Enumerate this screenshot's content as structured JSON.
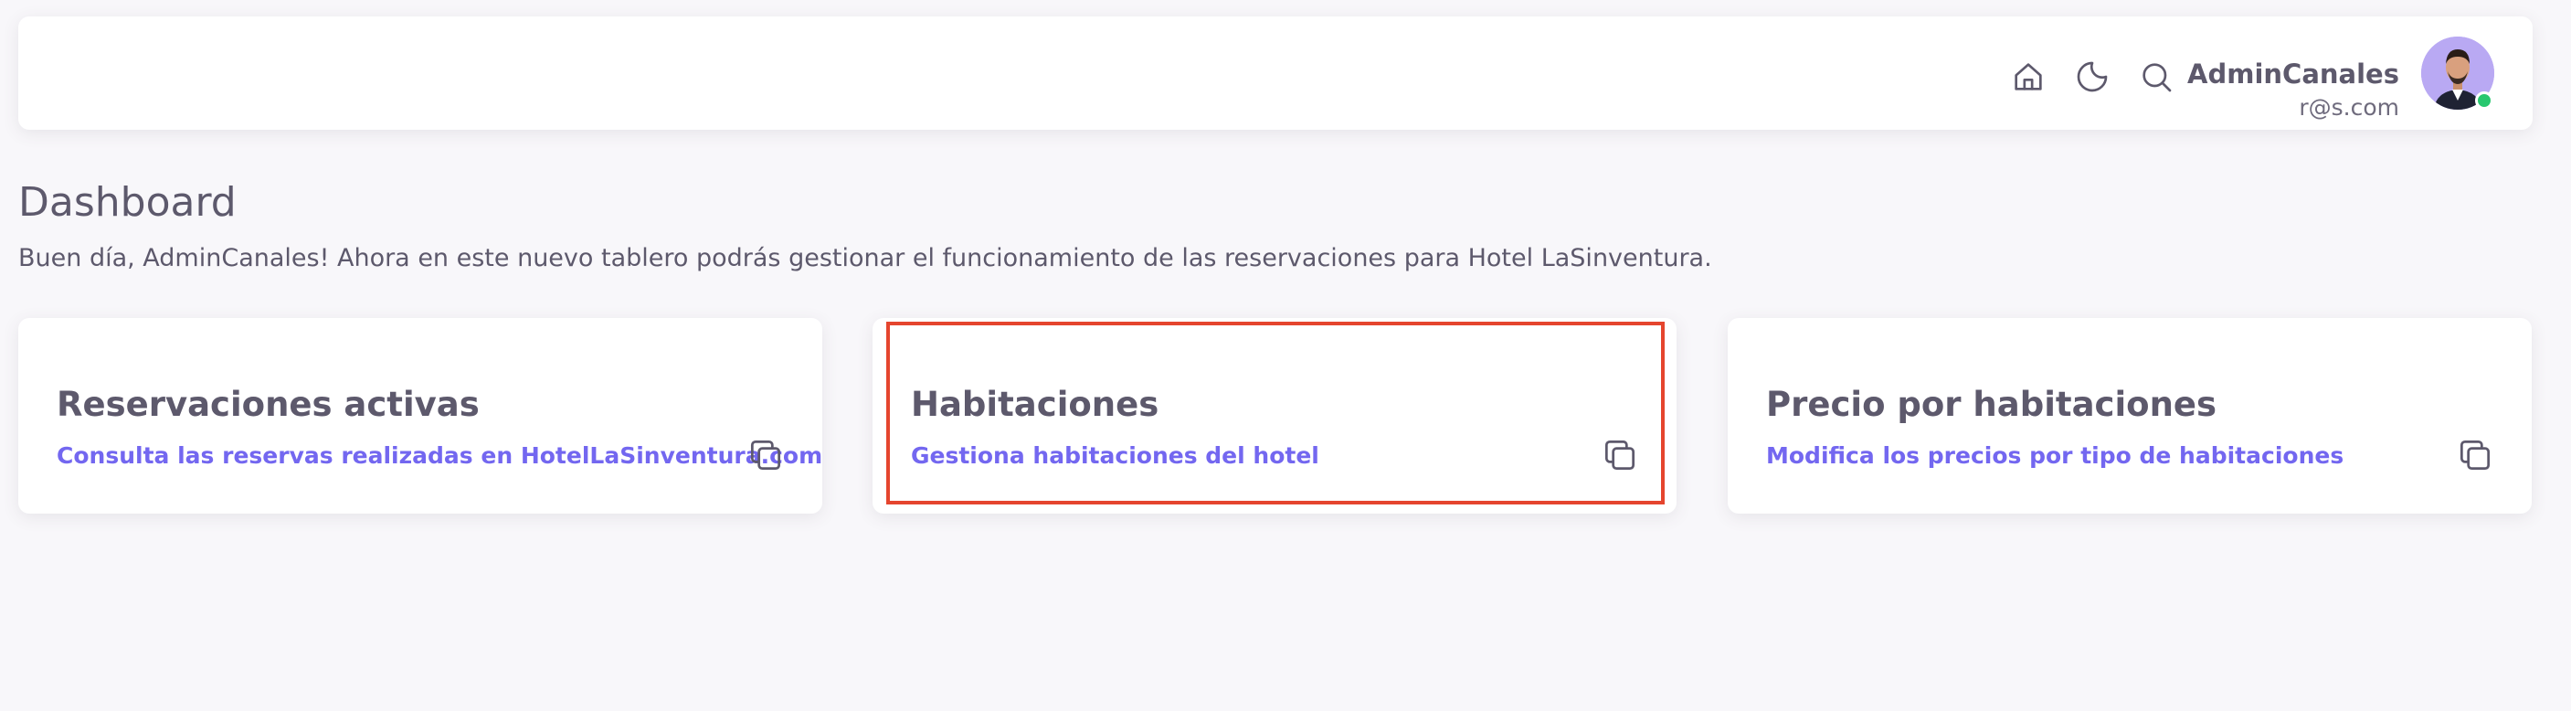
{
  "header": {
    "icons": [
      "home-icon",
      "moon-icon",
      "search-icon"
    ],
    "user": {
      "name": "AdminCanales",
      "email": "r@s.com",
      "status_color": "#28c76f"
    }
  },
  "page": {
    "title": "Dashboard",
    "subtitle": "Buen día, AdminCanales! Ahora en este nuevo tablero podrás gestionar el funcionamiento de las reservaciones para Hotel LaSinventura."
  },
  "cards": [
    {
      "title": "Reservaciones activas",
      "description": "Consulta las reservas realizadas en HotelLaSinventura.com",
      "icon": "copy-icon"
    },
    {
      "title": "Habitaciones",
      "description": "Gestiona habitaciones del hotel",
      "icon": "copy-icon",
      "highlighted": true
    },
    {
      "title": "Precio por habitaciones",
      "description": "Modifica los precios por tipo de habitaciones",
      "icon": "copy-icon"
    }
  ],
  "colors": {
    "accent": "#7367f0",
    "text": "#5d596c",
    "highlight": "#e5452e",
    "background": "#f8f7fa"
  }
}
